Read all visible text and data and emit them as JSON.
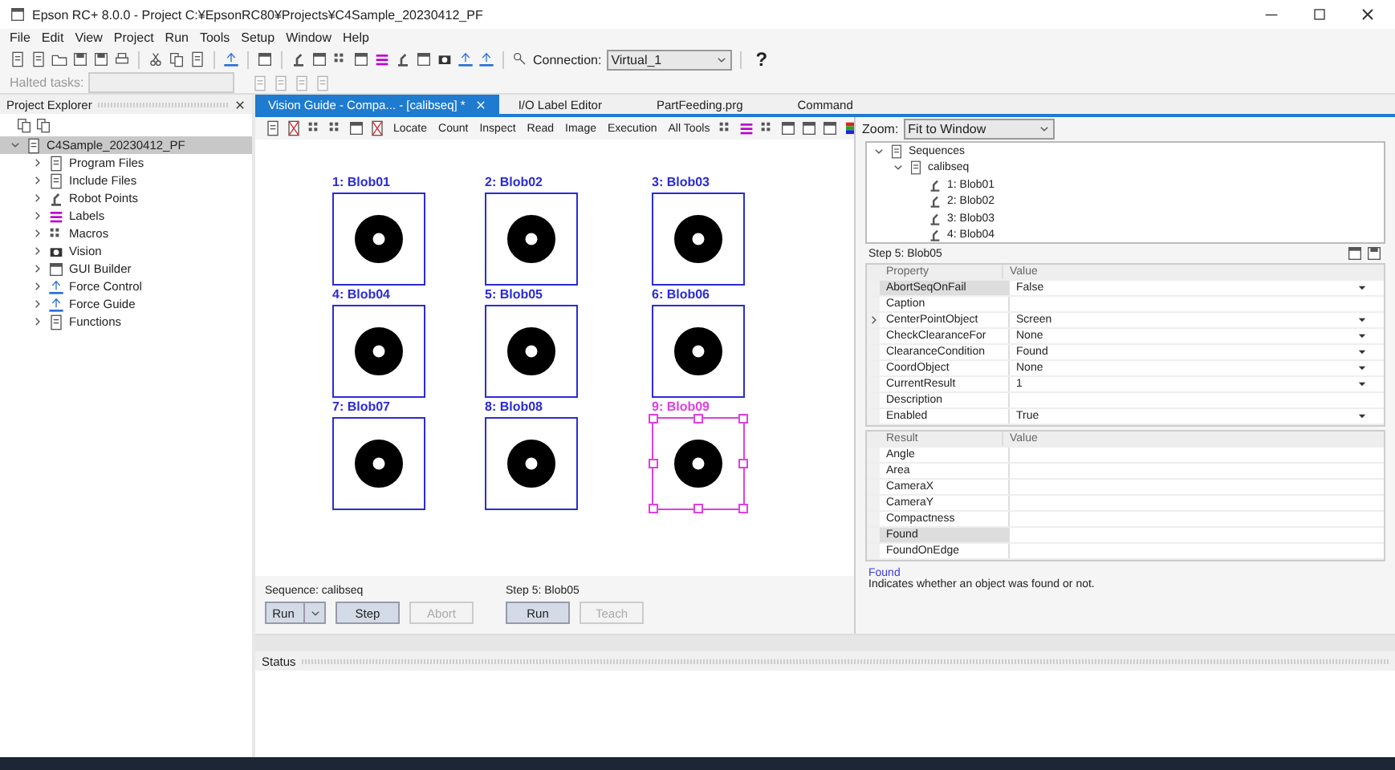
{
  "window": {
    "title": "Epson RC+ 8.0.0 - Project C:¥EpsonRC80¥Projects¥C4Sample_20230412_PF"
  },
  "menu": [
    "File",
    "Edit",
    "View",
    "Project",
    "Run",
    "Tools",
    "Setup",
    "Window",
    "Help"
  ],
  "toolbar": {
    "connection_label": "Connection:",
    "connection_value": "Virtual_1",
    "help": "?"
  },
  "halted": {
    "label": "Halted tasks:"
  },
  "project_explorer": {
    "title": "Project Explorer",
    "tree": [
      {
        "label": "C4Sample_20230412_PF",
        "expanded": true,
        "selected": true,
        "children": [
          {
            "label": "Program Files",
            "expanded": false,
            "selected": false
          },
          {
            "label": "Include Files",
            "expanded": false,
            "selected": false
          },
          {
            "label": "Robot Points",
            "expanded": false,
            "selected": false
          },
          {
            "label": "Labels",
            "expanded": false,
            "selected": false
          },
          {
            "label": "Macros",
            "expanded": false,
            "selected": false
          },
          {
            "label": "Vision",
            "expanded": false,
            "selected": false
          },
          {
            "label": "GUI Builder",
            "expanded": false,
            "selected": false
          },
          {
            "label": "Force Control",
            "expanded": false,
            "selected": false
          },
          {
            "label": "Force Guide",
            "expanded": false,
            "selected": false
          },
          {
            "label": "Functions",
            "expanded": false,
            "selected": false
          }
        ]
      }
    ]
  },
  "tabs": [
    {
      "label": "Vision Guide - Compa... - [calibseq] *",
      "selected": true
    },
    {
      "label": "I/O Label Editor",
      "selected": false
    },
    {
      "label": "PartFeeding.prg",
      "selected": false
    },
    {
      "label": "Command",
      "selected": false
    }
  ],
  "vision_toolbar": [
    "Locate",
    "Count",
    "Inspect",
    "Read",
    "Image",
    "Execution",
    "All Tools"
  ],
  "zoom": {
    "label": "Zoom:",
    "value": "Fit to Window"
  },
  "blobs": [
    {
      "label": "1: Blob01",
      "selected": false
    },
    {
      "label": "2: Blob02",
      "selected": false
    },
    {
      "label": "3: Blob03",
      "selected": false
    },
    {
      "label": "4: Blob04",
      "selected": false
    },
    {
      "label": "5: Blob05",
      "selected": false
    },
    {
      "label": "6: Blob06",
      "selected": false
    },
    {
      "label": "7: Blob07",
      "selected": false
    },
    {
      "label": "8: Blob08",
      "selected": false
    },
    {
      "label": "9: Blob09",
      "selected": true
    }
  ],
  "sequence_tree": [
    {
      "label": "Sequences",
      "expanded": true,
      "children": [
        {
          "label": "calibseq",
          "expanded": true,
          "children": [
            {
              "label": "1: Blob01"
            },
            {
              "label": "2: Blob02"
            },
            {
              "label": "3: Blob03"
            },
            {
              "label": "4: Blob04"
            }
          ]
        }
      ]
    }
  ],
  "step_title": "Step 5: Blob05",
  "properties": {
    "columns": [
      "Property",
      "Value"
    ],
    "rows": [
      {
        "name": "AbortSeqOnFail",
        "value": "False",
        "dropdown": true,
        "selected": true,
        "expandable": false
      },
      {
        "name": "Caption",
        "value": "",
        "dropdown": false,
        "selected": false,
        "expandable": false
      },
      {
        "name": "CenterPointObject",
        "value": "Screen",
        "dropdown": true,
        "selected": false,
        "expandable": true
      },
      {
        "name": "CheckClearanceFor",
        "value": "None",
        "dropdown": true,
        "selected": false,
        "expandable": false
      },
      {
        "name": "ClearanceCondition",
        "value": "Found",
        "dropdown": true,
        "selected": false,
        "expandable": false
      },
      {
        "name": "CoordObject",
        "value": "None",
        "dropdown": true,
        "selected": false,
        "expandable": false
      },
      {
        "name": "CurrentResult",
        "value": "1",
        "dropdown": true,
        "selected": false,
        "expandable": false
      },
      {
        "name": "Description",
        "value": "",
        "dropdown": false,
        "selected": false,
        "expandable": false
      },
      {
        "name": "Enabled",
        "value": "True",
        "dropdown": true,
        "selected": false,
        "expandable": false
      }
    ]
  },
  "results": {
    "columns": [
      "Result",
      "Value"
    ],
    "rows": [
      {
        "name": "Angle",
        "selected": false
      },
      {
        "name": "Area",
        "selected": false
      },
      {
        "name": "CameraX",
        "selected": false
      },
      {
        "name": "CameraY",
        "selected": false
      },
      {
        "name": "Compactness",
        "selected": false
      },
      {
        "name": "Found",
        "selected": true
      },
      {
        "name": "FoundOnEdge",
        "selected": false
      }
    ]
  },
  "description": {
    "title": "Found",
    "text": "Indicates whether an object was found or not."
  },
  "sequence_controls": {
    "label": "Sequence: calibseq",
    "buttons": [
      {
        "label": "Run",
        "kind": "split",
        "disabled": false
      },
      {
        "label": "Step",
        "kind": "plain",
        "disabled": false
      },
      {
        "label": "Abort",
        "kind": "plain",
        "disabled": true
      }
    ]
  },
  "step_controls": {
    "label": "Step 5: Blob05",
    "buttons": [
      {
        "label": "Run",
        "kind": "plain",
        "disabled": false
      },
      {
        "label": "Teach",
        "kind": "plain",
        "disabled": true
      }
    ]
  },
  "status": {
    "title": "Status"
  }
}
